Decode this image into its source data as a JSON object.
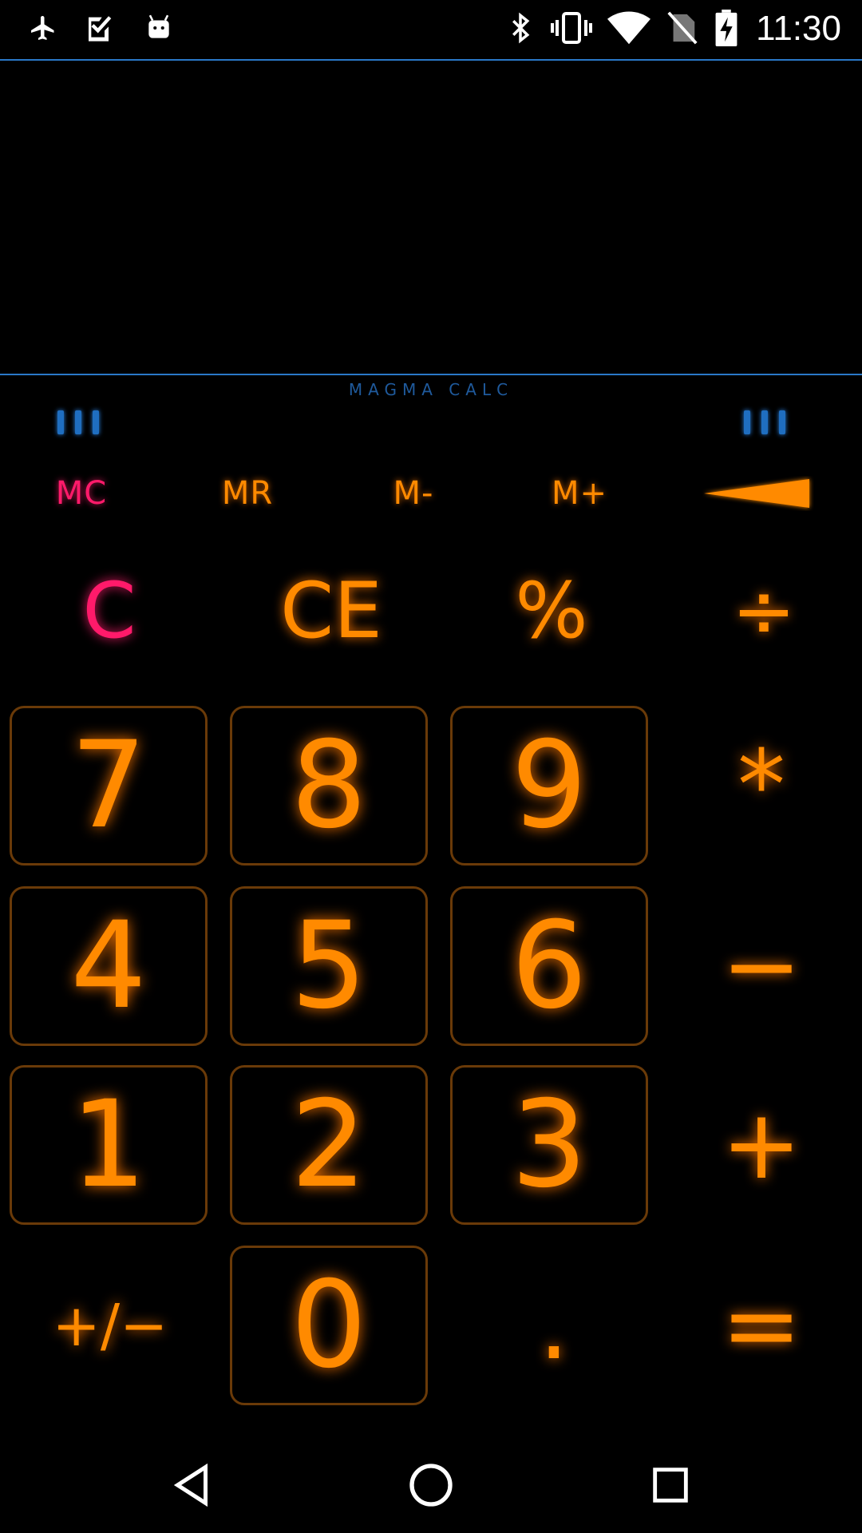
{
  "status_bar": {
    "time": "11:30",
    "left_icons": [
      "airplane-icon",
      "checklist-icon",
      "android-icon"
    ],
    "right_icons": [
      "bluetooth-icon",
      "vibrate-icon",
      "wifi-icon",
      "no-sim-icon",
      "battery-charging-icon"
    ]
  },
  "app": {
    "brand": "MAGMA CALC",
    "display_value": ""
  },
  "memory_row": {
    "mc": "MC",
    "mr": "MR",
    "m_minus": "M-",
    "m_plus": "M+",
    "backspace_icon": "backspace-wedge-icon"
  },
  "function_row": {
    "clear": "C",
    "clear_entry": "CE",
    "percent": "%",
    "divide": "÷"
  },
  "digits": {
    "d7": "7",
    "d8": "8",
    "d9": "9",
    "d4": "4",
    "d5": "5",
    "d6": "6",
    "d1": "1",
    "d2": "2",
    "d3": "3",
    "d0": "0"
  },
  "operators": {
    "multiply": "*",
    "minus": "−",
    "plus": "+",
    "equals": "=",
    "sign": "+/−",
    "decimal": "."
  },
  "colors": {
    "accent_orange": "#ff8a00",
    "accent_pink": "#ff1a6a",
    "divider_blue": "#2a78c8",
    "key_border": "#6a3a08"
  },
  "nav_bar": {
    "icons": [
      "back-icon",
      "home-icon",
      "recents-icon"
    ]
  }
}
